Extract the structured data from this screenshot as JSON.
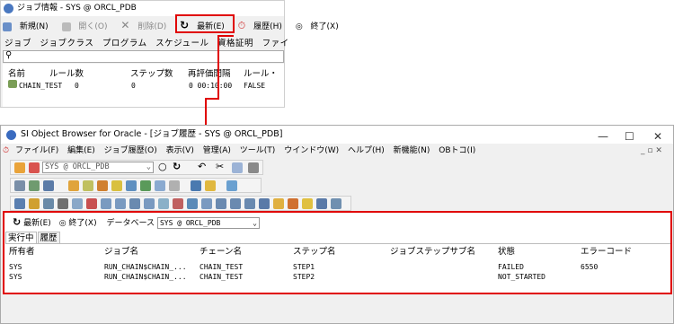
{
  "top_window": {
    "title": "ジョブ情報 - SYS @ ORCL_PDB",
    "toolbar": [
      "新規(N)",
      "開く(O)",
      "削除(D)",
      "最新(E)",
      "履歴(H)",
      "終了(X)"
    ],
    "tabs": [
      "ジョブ",
      "ジョブクラス",
      "プログラム",
      "スケジュール",
      "資格証明",
      "ファイ"
    ],
    "columns": [
      "名前",
      "ルール数",
      "ステップ数",
      "再評価間隔",
      "ルール・"
    ],
    "row": [
      "CHAIN_TEST",
      "0",
      "0",
      "0 00:10:00",
      "FALSE"
    ]
  },
  "main_window": {
    "title": "SI Object Browser for Oracle - [ジョブ履歴 - SYS @ ORCL_PDB]",
    "menu": [
      "ファイル(F)",
      "編集(E)",
      "ジョブ履歴(O)",
      "表示(V)",
      "管理(A)",
      "ツール(T)",
      "ウインドウ(W)",
      "ヘルプ(H)",
      "新機能(N)",
      "OBトコ(I)"
    ],
    "connection": "SYS @ ORCL_PDB",
    "panel_toolbar": {
      "refresh": "最新(E)",
      "close": "終了(X)",
      "db_label": "データベース",
      "db_value": "SYS @ ORCL_PDB"
    },
    "tabs": [
      "実行中",
      "履歴"
    ],
    "columns": [
      "所有者",
      "ジョブ名",
      "チェーン名",
      "ステップ名",
      "ジョブステップサブ名",
      "状態",
      "エラーコード"
    ],
    "rows": [
      [
        "SYS",
        "RUN_CHAIN$CHAIN_...",
        "CHAIN_TEST",
        "STEP1",
        "",
        "FAILED",
        "6550"
      ],
      [
        "SYS",
        "RUN_CHAIN$CHAIN_...",
        "CHAIN_TEST",
        "STEP2",
        "",
        "NOT_STARTED",
        ""
      ]
    ]
  },
  "colors": {
    "highlight": "#e00000"
  }
}
